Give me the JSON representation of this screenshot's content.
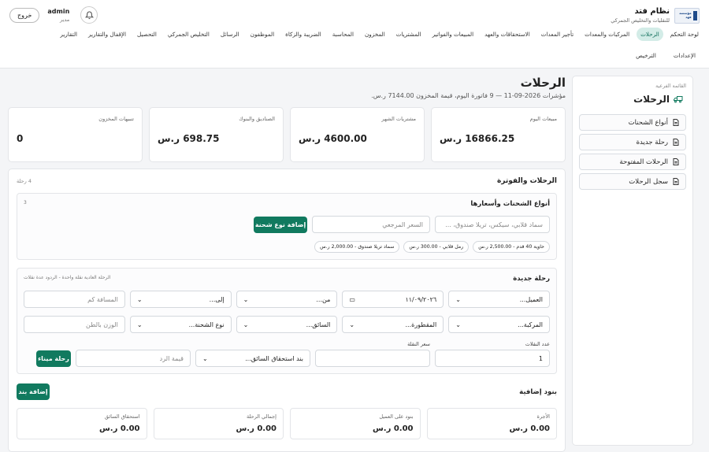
{
  "brand": {
    "title": "نظام فتد",
    "subtitle": "للنقليات والتخليص الجمركي",
    "logo_text": "مؤسسة فهد"
  },
  "user": {
    "name": "admin",
    "role": "مدير",
    "logout_label": "خروج"
  },
  "nav": {
    "items": [
      "لوحة التحكم",
      "الرحلات",
      "المركبات والمعدات",
      "تأجير المعدات",
      "الاستحقاقات والعهد",
      "المبيعات والفواتير",
      "المشتريات",
      "المخزون",
      "المحاسبة",
      "الضريبة والزكاة",
      "الموظفون",
      "الرسائل",
      "التخليص الجمركي",
      "التحصيل",
      "الإقفال والتقارير",
      "التقارير"
    ],
    "row2": [
      "الإعدادات",
      "الترخيص"
    ]
  },
  "sidebar": {
    "hint": "القائمة الفرعية",
    "title": "الرحلات",
    "items": [
      "أنواع الشحنات",
      "رحلة جديدة",
      "الرحلات المفتوحة",
      "سجل الرحلات"
    ]
  },
  "page": {
    "title": "الرحلات",
    "subtitle": "مؤشرات 2026-09-11 — 9 فاتورة اليوم، قيمة المخزون 7144.00 ر.س."
  },
  "stats": [
    {
      "label": "مبيعات اليوم",
      "value": "16866.25 ر.س"
    },
    {
      "label": "مشتريات الشهر",
      "value": "4600.00 ر.س"
    },
    {
      "label": "الصناديق والبنوك",
      "value": "698.75 ر.س"
    },
    {
      "label": "تنبيهات المخزون",
      "value": "0"
    }
  ],
  "trips": {
    "title": "الرحلات والفوترة",
    "count": "4 رحلة"
  },
  "shipment_types": {
    "title": "أنواع الشحنات وأسعارها",
    "count": "3",
    "name_placeholder": "سماد قلابي، سيكس، تريلا صندوق، ...",
    "price_placeholder": "السعر المرجعي",
    "add_label": "إضافة نوع شحنة",
    "chips": [
      "حاوية 40 قدم - 2,500.00 ر.س",
      "رمل قلابي - 300.00 ر.س",
      "سماد تريلا صندوق - 2,000.00 ر.س"
    ]
  },
  "new_trip": {
    "title": "رحلة جديدة",
    "note": "الرحلة العادية نقلة واحدة - الردود عدة نقلات",
    "customer": "العميل...",
    "date": "١١/٠٩/٢٠٢٦",
    "from": "من...",
    "to": "إلى...",
    "distance_placeholder": "المسافة كم",
    "vehicle": "المركبة...",
    "trailer": "المقطورة...",
    "driver": "السائق...",
    "shipment_type": "نوع الشحنة...",
    "weight_placeholder": "الوزن بالطن",
    "trips_count_label": "عدد النقلات",
    "trips_count_value": "1",
    "trip_price_label": "سعر النقلة",
    "driver_due": "بند استحقاق السائق...",
    "return_value_placeholder": "قيمة الرد",
    "port_trip_label": "رحلة ميناء"
  },
  "extras": {
    "title": "بنود إضافية",
    "add_label": "إضافة بند"
  },
  "totals": [
    {
      "label": "الأجرة",
      "value": "0.00 ر.س"
    },
    {
      "label": "بنود على العميل",
      "value": "0.00 ر.س"
    },
    {
      "label": "إجمالي الرحلة",
      "value": "0.00 ر.س"
    },
    {
      "label": "استحقاق السائق",
      "value": "0.00 ر.س"
    }
  ]
}
